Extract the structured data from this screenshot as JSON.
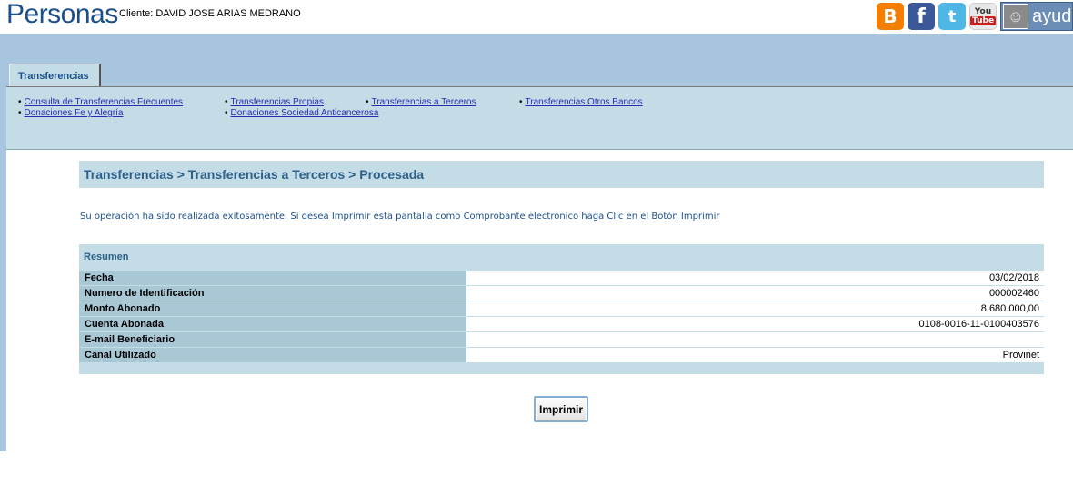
{
  "header": {
    "brand": "Personas",
    "client": "Cliente: DAVID JOSE ARIAS MEDRANO",
    "social": [
      {
        "name": "blogger-icon",
        "glyph": "B"
      },
      {
        "name": "facebook-icon",
        "glyph": "f"
      },
      {
        "name": "twitter-icon",
        "glyph": "t"
      }
    ],
    "youtube": {
      "line1": "You",
      "line2": "Tube"
    },
    "help_label": "ayud"
  },
  "tab": {
    "label": "Transferencias"
  },
  "menu": [
    {
      "label": "Consulta de Transferencias Frecuentes"
    },
    {
      "label": "Donaciones Fe y Alegría"
    },
    {
      "label": "Transferencias Propias"
    },
    {
      "label": "Donaciones Sociedad Anticancerosa"
    },
    {
      "label": "Transferencias a Terceros"
    },
    {
      "label": "Transferencias Otros Bancos"
    }
  ],
  "breadcrumb": "Transferencias > Transferencias a Terceros > Procesada",
  "message": "Su operación ha sido realizada exitosamente. Si desea Imprimir esta pantalla como Comprobante electrónico haga Clic en el Botón Imprimir",
  "summary": {
    "title": "Resumen",
    "rows": [
      {
        "label": "Fecha",
        "value": "03/02/2018"
      },
      {
        "label": "Numero de Identificación",
        "value": "000002460"
      },
      {
        "label": "Monto Abonado",
        "value": "8.680.000,00"
      },
      {
        "label": "Cuenta Abonada",
        "value": "0108-0016-11-0100403576"
      },
      {
        "label": "E-mail Beneficiario",
        "value": ""
      },
      {
        "label": "Canal Utilizado",
        "value": "Provinet"
      }
    ]
  },
  "print_button": "Imprimir",
  "colors": {
    "brand": "#1a4f8a",
    "band": "#a8c5e0",
    "panel": "#c3dce6",
    "link": "#2b2bb5"
  }
}
